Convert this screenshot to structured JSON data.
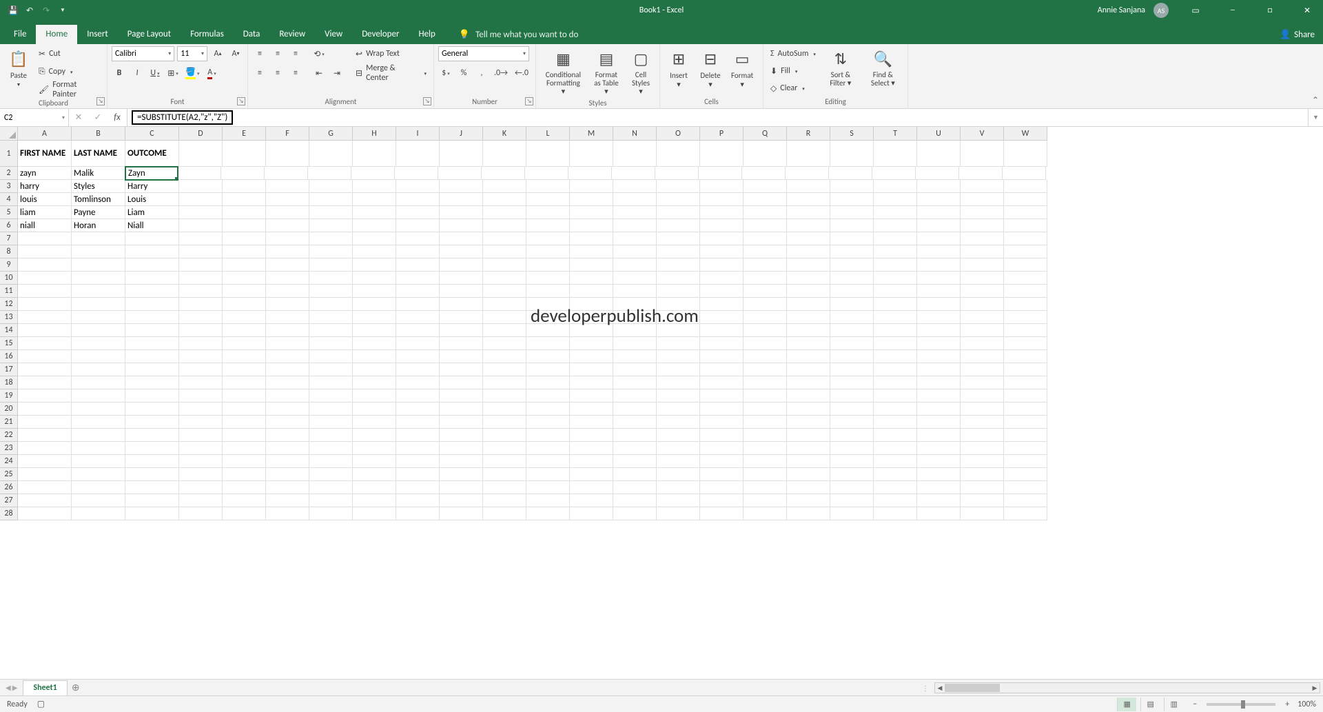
{
  "title": "Book1 - Excel",
  "user": {
    "name": "Annie Sanjana",
    "initials": "AS"
  },
  "tabs": [
    "File",
    "Home",
    "Insert",
    "Page Layout",
    "Formulas",
    "Data",
    "Review",
    "View",
    "Developer",
    "Help"
  ],
  "active_tab": "Home",
  "tell_me": "Tell me what you want to do",
  "share": "Share",
  "clipboard": {
    "paste": "Paste",
    "cut": "Cut",
    "copy": "Copy",
    "fp": "Format Painter",
    "label": "Clipboard"
  },
  "font": {
    "name": "Calibri",
    "size": "11",
    "label": "Font"
  },
  "alignment": {
    "wrap": "Wrap Text",
    "merge": "Merge & Center",
    "label": "Alignment"
  },
  "number": {
    "format": "General",
    "label": "Number"
  },
  "styles": {
    "cf": "Conditional Formatting",
    "fat": "Format as Table",
    "cs": "Cell Styles",
    "label": "Styles"
  },
  "cells_grp": {
    "ins": "Insert",
    "del": "Delete",
    "fmt": "Format",
    "label": "Cells"
  },
  "editing": {
    "sum": "AutoSum",
    "fill": "Fill",
    "clear": "Clear",
    "sort": "Sort & Filter",
    "find": "Find & Select",
    "label": "Editing"
  },
  "namebox": "C2",
  "formula": "=SUBSTITUTE(A2,\"z\",\"Z\")",
  "columns": [
    "A",
    "B",
    "C",
    "D",
    "E",
    "F",
    "G",
    "H",
    "I",
    "J",
    "K",
    "L",
    "M",
    "N",
    "O",
    "P",
    "Q",
    "R",
    "S",
    "T",
    "U",
    "V",
    "W"
  ],
  "rows": [
    1,
    2,
    3,
    4,
    5,
    6,
    7,
    8,
    9,
    10,
    11,
    12,
    13,
    14,
    15,
    16,
    17,
    18,
    19,
    20,
    21,
    22,
    23,
    24,
    25,
    26,
    27,
    28
  ],
  "row1_height": 38,
  "header_row": {
    "a": "FIRST NAME",
    "b": "LAST NAME",
    "c": "OUTCOME"
  },
  "data_rows": [
    {
      "a": "zayn",
      "b": "Malik",
      "c": "Zayn"
    },
    {
      "a": "harry",
      "b": "Styles",
      "c": "Harry"
    },
    {
      "a": "louis",
      "b": "Tomlinson",
      "c": "Louis"
    },
    {
      "a": "liam",
      "b": "Payne",
      "c": "Liam"
    },
    {
      "a": "niall",
      "b": "Horan",
      "c": "Niall"
    }
  ],
  "selected_cell": {
    "row": 2,
    "col": "C"
  },
  "watermark": "developerpublish.com",
  "sheet": "Sheet1",
  "status": "Ready",
  "zoom": "100%"
}
